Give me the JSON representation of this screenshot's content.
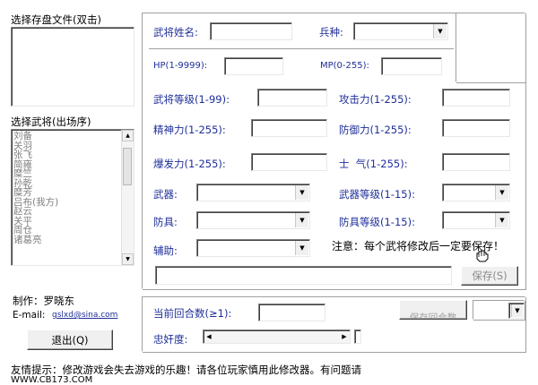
{
  "save_files": {
    "title": "选择存盘文件(双击)"
  },
  "generals": {
    "title": "选择武将(出场序)",
    "items": [
      "刘备",
      "关羽",
      "张飞",
      "简雍",
      "糜竺",
      "孙乾",
      "糜芳",
      "吕布(我方)",
      "赵云",
      "关平",
      "周仓",
      "诸葛亮"
    ]
  },
  "credits": {
    "maker_label": "制作：罗晓东",
    "email_label": "E-mail:",
    "email": "gslxd@sina.com"
  },
  "exit_button": "退出(Q)",
  "footer": {
    "tip": "友情提示：修改游戏会失去游戏的乐趣！请各位玩家慎用此修改器。有问题请",
    "url": "WWW.CB173.COM"
  },
  "form": {
    "name_label": "武将姓名:",
    "troop_label": "兵种:",
    "hp_label": "HP(1-9999):",
    "mp_label": "MP(0-255):",
    "level_label": "武将等级(1-99):",
    "attack_label": "攻击力(1-255):",
    "spirit_label": "精神力(1-255):",
    "defense_label": "防御力(1-255):",
    "burst_label": "爆发力(1-255):",
    "morale_label": "士  气(1-255):",
    "weapon_label": "武器:",
    "weapon_level_label": "武器等级(1-15):",
    "armor_label": "防具:",
    "armor_level_label": "防具等级(1-15):",
    "aux_label": "辅助:",
    "notice": "注意：每个武将修改后一定要保存！",
    "save_button": "保存(S)"
  },
  "bottom": {
    "round_label": "当前回合数(≥1):",
    "loyalty_label": "忠奸度:",
    "hidden_button": "保存回合数"
  }
}
